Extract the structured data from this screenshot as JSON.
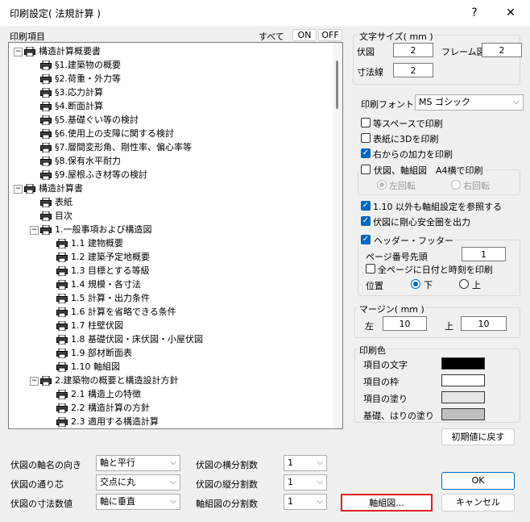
{
  "window": {
    "title": "印刷設定( 法規計算 )",
    "help": "?",
    "close": "✕"
  },
  "print_items": {
    "label": "印刷項目",
    "all_label": "すべて",
    "on": "ON",
    "off": "OFF"
  },
  "tree": [
    {
      "label": "構造計算概要書",
      "level": 0,
      "expander": "−"
    },
    {
      "label": "§1.建築物の概要",
      "level": 1
    },
    {
      "label": "§2.荷重・外力等",
      "level": 1
    },
    {
      "label": "§3.応力計算",
      "level": 1
    },
    {
      "label": "§4.断面計算",
      "level": 1
    },
    {
      "label": "§5.基礎ぐい等の検討",
      "level": 1
    },
    {
      "label": "§6.使用上の支障に関する検討",
      "level": 1
    },
    {
      "label": "§7.層間変形角、剛性率、偏心率等",
      "level": 1
    },
    {
      "label": "§8.保有水平耐力",
      "level": 1
    },
    {
      "label": "§9.屋根ふき材等の検討",
      "level": 1
    },
    {
      "label": "構造計算書",
      "level": 0,
      "expander": "−"
    },
    {
      "label": "表紙",
      "level": 1
    },
    {
      "label": "目次",
      "level": 1
    },
    {
      "label": "1.一般事項および構造図",
      "level": 1,
      "expander": "−"
    },
    {
      "label": "1.1 建物概要",
      "level": 2
    },
    {
      "label": "1.2 建築予定地概要",
      "level": 2
    },
    {
      "label": "1.3 目標とする等級",
      "level": 2
    },
    {
      "label": "1.4 規模・各寸法",
      "level": 2
    },
    {
      "label": "1.5 計算・出力条件",
      "level": 2
    },
    {
      "label": "1.6 計算を省略できる条件",
      "level": 2
    },
    {
      "label": "1.7 柱壁伏図",
      "level": 2
    },
    {
      "label": "1.8 基礎伏図・床伏図・小屋伏図",
      "level": 2
    },
    {
      "label": "1.9 部材断面表",
      "level": 2
    },
    {
      "label": "1.10 軸組図",
      "level": 2
    },
    {
      "label": "2.建築物の概要と構造設計方針",
      "level": 1,
      "expander": "−"
    },
    {
      "label": "2.1 構造上の特徴",
      "level": 2
    },
    {
      "label": "2.2 構造計算の方針",
      "level": 2
    },
    {
      "label": "2.3 適用する構造計算",
      "level": 2
    }
  ],
  "font_size": {
    "title": "文字サイズ( mm )",
    "fuzu_label": "伏図",
    "fuzu_value": "2",
    "frame_label": "フレーム図",
    "frame_value": "2",
    "sunpo_label": "寸法線",
    "sunpo_value": "2"
  },
  "print_font": {
    "label": "印刷フォント",
    "value": "MS ゴシック"
  },
  "options": {
    "equal_space": "等スペースで印刷",
    "table_3d": "表紙に3Dを印刷",
    "right_load": "右からの加力を印刷",
    "a4_label": "伏図、軸組図　A4横で印刷",
    "rot_left": "左回転",
    "rot_right": "右回転",
    "ref_axis": "1.10 以外も軸組設定を参照する",
    "rigid_circle": "伏図に剛心安全圏を出力"
  },
  "header_footer": {
    "label": "ヘッダー・フッター",
    "page_start_label": "ページ番号先頭",
    "page_start_value": "1",
    "date_label": "全ページに日付と時刻を印刷",
    "pos_label": "位置",
    "pos_bottom": "下",
    "pos_top": "上"
  },
  "margin": {
    "title": "マージン( mm )",
    "left_label": "左",
    "left_value": "10",
    "top_label": "上",
    "top_value": "10"
  },
  "print_color": {
    "title": "印刷色",
    "items": [
      {
        "label": "項目の文字",
        "color": "#000000"
      },
      {
        "label": "項目の枠",
        "color": "#ffffff"
      },
      {
        "label": "項目の塗り",
        "color": "#e6e6e6"
      },
      {
        "label": "基礎、はりの塗り",
        "color": "#c0c0c0"
      }
    ]
  },
  "reset_button": "初期値に戻す",
  "bottom": {
    "axis_dir_label": "伏図の軸名の向き",
    "axis_dir_value": "軸と平行",
    "div_h_label": "伏図の横分割数",
    "div_h_value": "1",
    "axis_core_label": "伏図の通り芯",
    "axis_core_value": "交点に丸",
    "div_v_label": "伏図の縦分割数",
    "div_v_value": "1",
    "dim_label": "伏図の寸法数値",
    "dim_value": "軸に垂直",
    "axis_div_label": "軸組図の分割数",
    "axis_div_value": "1"
  },
  "ok": "OK",
  "cancel": "キャンセル",
  "axis_button": "軸組図..."
}
